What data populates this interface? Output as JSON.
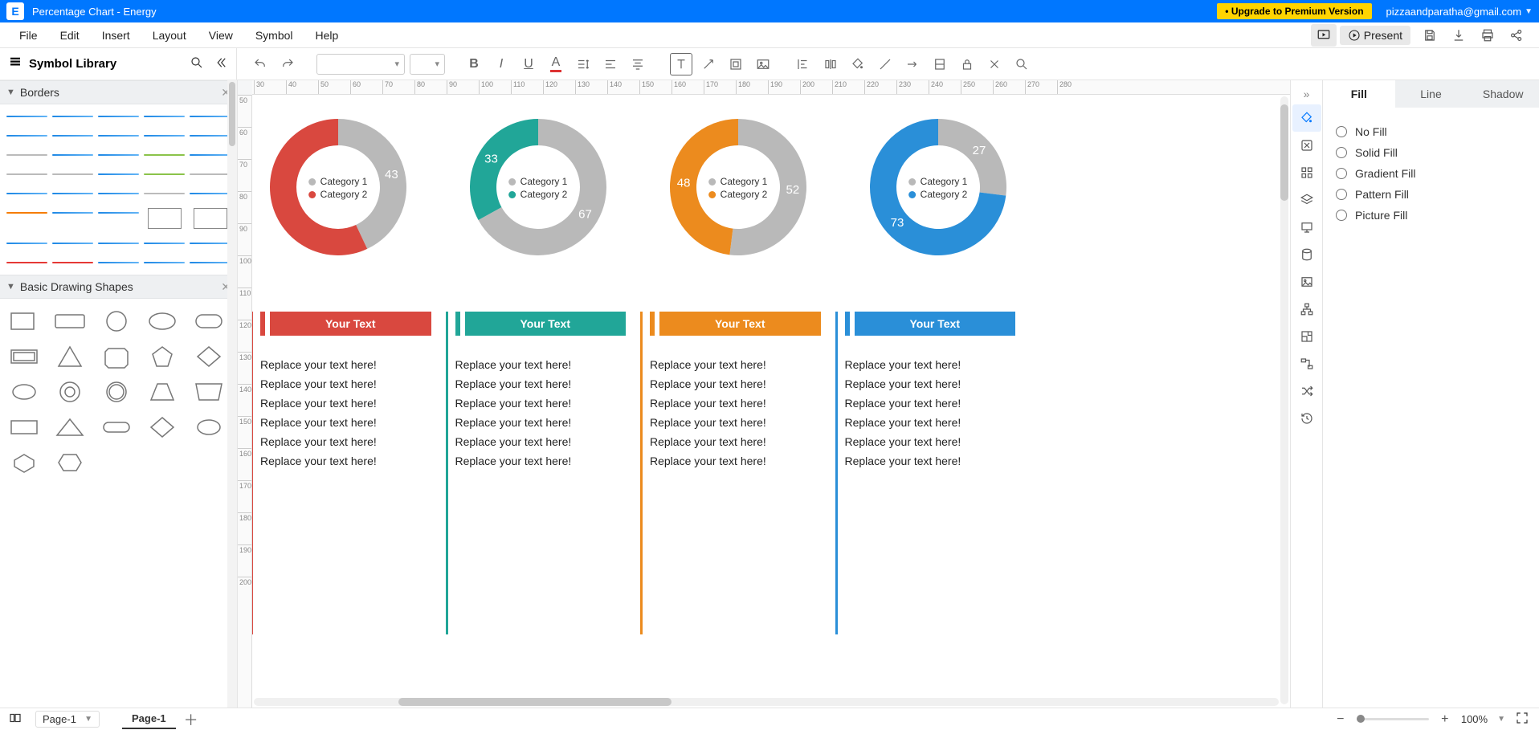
{
  "titlebar": {
    "app_logo_letter": "E",
    "document_title": "Percentage Chart - Energy",
    "premium_label": "• Upgrade to Premium Version",
    "account_email": "pizzaandparatha@gmail.com"
  },
  "menus": [
    "File",
    "Edit",
    "Insert",
    "Layout",
    "View",
    "Symbol",
    "Help"
  ],
  "present_label": "Present",
  "left_panel": {
    "title": "Symbol Library",
    "sections": {
      "borders": "Borders",
      "shapes": "Basic Drawing Shapes"
    }
  },
  "ruler_h": [
    "30",
    "40",
    "50",
    "60",
    "70",
    "80",
    "90",
    "100",
    "110",
    "120",
    "130",
    "140",
    "150",
    "160",
    "170",
    "180",
    "190",
    "200",
    "210",
    "220",
    "230",
    "240",
    "250",
    "260",
    "270",
    "280"
  ],
  "ruler_v": [
    "50",
    "60",
    "70",
    "80",
    "90",
    "100",
    "110",
    "120",
    "130",
    "140",
    "150",
    "160",
    "170",
    "180",
    "190",
    "200"
  ],
  "chart_data": [
    {
      "type": "donut",
      "color_cat1": "#b9b9b9",
      "color_cat2": "#d9483f",
      "categories": [
        "Category 1",
        "Category 2"
      ],
      "values": [
        43,
        57
      ],
      "labels": {
        "cat1": "43"
      }
    },
    {
      "type": "donut",
      "color_cat1": "#b9b9b9",
      "color_cat2": "#21a698",
      "categories": [
        "Category 1",
        "Category 2"
      ],
      "values": [
        67,
        33
      ],
      "labels": {
        "cat1": "67",
        "cat2": "33"
      }
    },
    {
      "type": "donut",
      "color_cat1": "#b9b9b9",
      "color_cat2": "#ec8b1e",
      "categories": [
        "Category 1",
        "Category 2"
      ],
      "values": [
        52,
        48
      ],
      "labels": {
        "cat1": "52",
        "cat2": "48"
      }
    },
    {
      "type": "donut",
      "color_cat1": "#b9b9b9",
      "color_cat2": "#2a8fd8",
      "categories": [
        "Category 1",
        "Category 2"
      ],
      "values": [
        27,
        73
      ],
      "labels": {
        "cat1": "27",
        "cat2": "73"
      }
    }
  ],
  "text_columns": [
    {
      "accent": "#d9483f",
      "header": "Your Text",
      "lines": [
        "Replace your text here!",
        "Replace your text here!",
        "Replace your text here!",
        "Replace your text here!",
        "Replace your text here!",
        "Replace your text here!"
      ]
    },
    {
      "accent": "#21a698",
      "header": "Your Text",
      "lines": [
        "Replace your text here!",
        "Replace your text here!",
        "Replace your text here!",
        "Replace your text here!",
        "Replace your text here!",
        "Replace your text here!"
      ]
    },
    {
      "accent": "#ec8b1e",
      "header": "Your Text",
      "lines": [
        "Replace your text here!",
        "Replace your text here!",
        "Replace your text here!",
        "Replace your text here!",
        "Replace your text here!",
        "Replace your text here!"
      ]
    },
    {
      "accent": "#2a8fd8",
      "header": "Your Text",
      "lines": [
        "Replace your text here!",
        "Replace your text here!",
        "Replace your text here!",
        "Replace your text here!",
        "Replace your text here!",
        "Replace your text here!"
      ]
    }
  ],
  "legend_labels": {
    "cat1": "Category 1",
    "cat2": "Category 2"
  },
  "right_panel": {
    "tabs": [
      "Fill",
      "Line",
      "Shadow"
    ],
    "active_tab": "Fill",
    "fill_options": [
      "No Fill",
      "Solid Fill",
      "Gradient Fill",
      "Pattern Fill",
      "Picture Fill"
    ]
  },
  "statusbar": {
    "page_selector": "Page-1",
    "active_page_tab": "Page-1",
    "zoom_label": "100%"
  }
}
